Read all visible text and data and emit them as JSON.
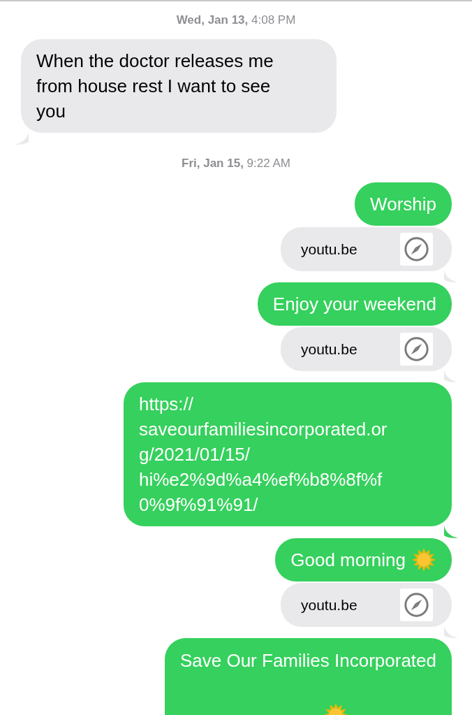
{
  "messages": [
    {
      "kind": "timestamp",
      "day": "Wed, Jan 13,",
      "time": "4:08 PM"
    },
    {
      "kind": "incoming",
      "text": "When the doctor releases me from house rest I want to see you",
      "tail": true
    },
    {
      "kind": "timestamp",
      "day": "Fri, Jan 15,",
      "time": "9:22 AM"
    },
    {
      "kind": "outgoing",
      "text": "Worship",
      "tail": false
    },
    {
      "kind": "link",
      "text": "youtu.be",
      "tail": true
    },
    {
      "kind": "outgoing",
      "text": "Enjoy your weekend",
      "tail": false
    },
    {
      "kind": "link",
      "text": "youtu.be",
      "tail": true
    },
    {
      "kind": "outgoing",
      "text": "https:// saveourfamiliesincorporated.or g/2021/01/15/ hi%e2%9d%a4%ef%b8%8f%f 0%9f%91%91/",
      "tail": true
    },
    {
      "kind": "outgoing_sun",
      "text": "Good morning",
      "tail": false
    },
    {
      "kind": "link",
      "text": "youtu.be",
      "tail": true
    },
    {
      "kind": "outgoing_sun_below",
      "text": "Save Our Families Incorporated",
      "tail": false
    }
  ]
}
